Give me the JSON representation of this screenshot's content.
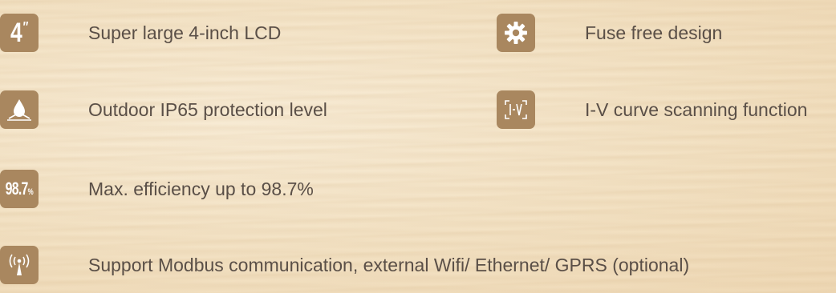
{
  "features": [
    {
      "icon": "four-inch-lcd-icon",
      "icon_text": "4",
      "icon_suffix": "″",
      "label": "Super large 4-inch LCD"
    },
    {
      "icon": "water-drop-icon",
      "label": "Outdoor IP65 protection level"
    },
    {
      "icon": "efficiency-icon",
      "icon_text": "98.7",
      "icon_suffix": "%",
      "label": "Max. efficiency up to 98.7%"
    },
    {
      "icon": "antenna-signal-icon",
      "label": "Support Modbus communication, external Wifi/ Ethernet/ GPRS (optional)"
    },
    {
      "icon": "gear-icon",
      "label": "Fuse free design"
    },
    {
      "icon": "iv-curve-icon",
      "label": "I-V curve scanning function"
    }
  ],
  "colors": {
    "icon_bg": "#a9875f",
    "text": "#5a4f47",
    "background": "#f3e2c4"
  }
}
